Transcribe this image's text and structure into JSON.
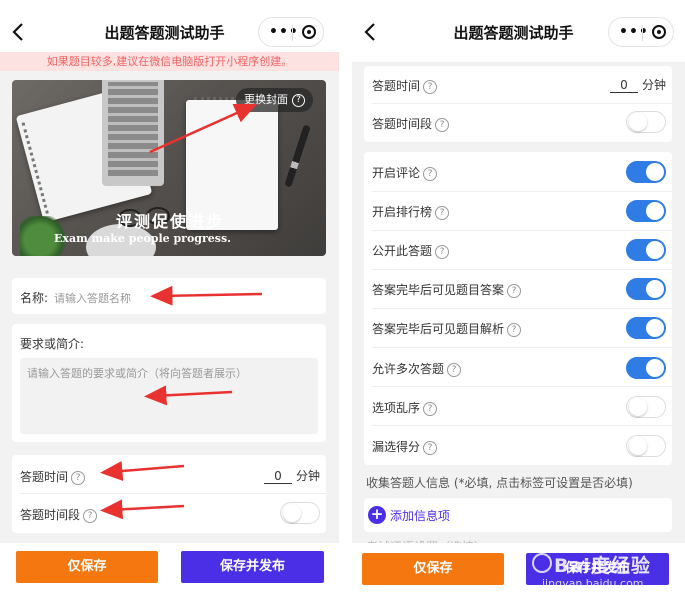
{
  "left": {
    "nav": {
      "back_icon": "chevron-left-icon",
      "title": "出题答题测试助手",
      "menu_icon": "more-dots-icon",
      "close_icon": "target-icon"
    },
    "notice": "如果题目较多,建议在微信电脑版打开小程序创建。",
    "cover": {
      "slogan": "评测促使进步",
      "slogan_en": "Exam make people progress.",
      "change_cover_label": "更换封面",
      "help_mark": "?"
    },
    "name_field": {
      "label": "名称:",
      "placeholder": "请输入答题名称"
    },
    "intro_field": {
      "label": "要求或简介:",
      "placeholder": "请输入答题的要求或简介（将向答题者展示）"
    },
    "settings": [
      {
        "label": "答题时间",
        "value": "0",
        "unit": "分钟"
      },
      {
        "label": "答题时间段",
        "toggle": "off"
      }
    ],
    "buttons": {
      "save": "仅保存",
      "save_publish": "保存并发布"
    },
    "annotation_color": "#e8322f"
  },
  "right": {
    "nav": {
      "back_icon": "chevron-left-icon",
      "title": "出题答题测试助手",
      "menu_icon": "more-dots-icon",
      "close_icon": "target-icon"
    },
    "time_settings": [
      {
        "label": "答题时间",
        "value": "0",
        "unit": "分钟"
      },
      {
        "label": "答题时间段",
        "toggle": "off"
      }
    ],
    "toggles": [
      {
        "label": "开启评论",
        "on": true
      },
      {
        "label": "开启排行榜",
        "on": true
      },
      {
        "label": "公开此答题",
        "on": true
      },
      {
        "label": "答案完毕后可见题目答案",
        "on": true
      },
      {
        "label": "答案完毕后可见题目解析",
        "on": true
      },
      {
        "label": "允许多次答题",
        "on": true
      },
      {
        "label": "选项乱序",
        "on": false
      },
      {
        "label": "漏选得分",
        "on": false
      }
    ],
    "collect_note": "收集答题人信息 (*必填, 点击标签可设置是否必填)",
    "add_info": "添加信息项",
    "faded_label": "考试评语设置（选填）",
    "buttons": {
      "save": "仅保存",
      "save_publish": "保存并发布"
    },
    "watermark": {
      "brand": "Bai度经验",
      "url": "jingyan.baidu.com"
    }
  },
  "colors": {
    "toggle_on": "#2f7ce5",
    "orange": "#f5770f",
    "blue": "#4b2fe6",
    "notice_bg": "#fde2e2",
    "notice_text": "#f06464"
  }
}
